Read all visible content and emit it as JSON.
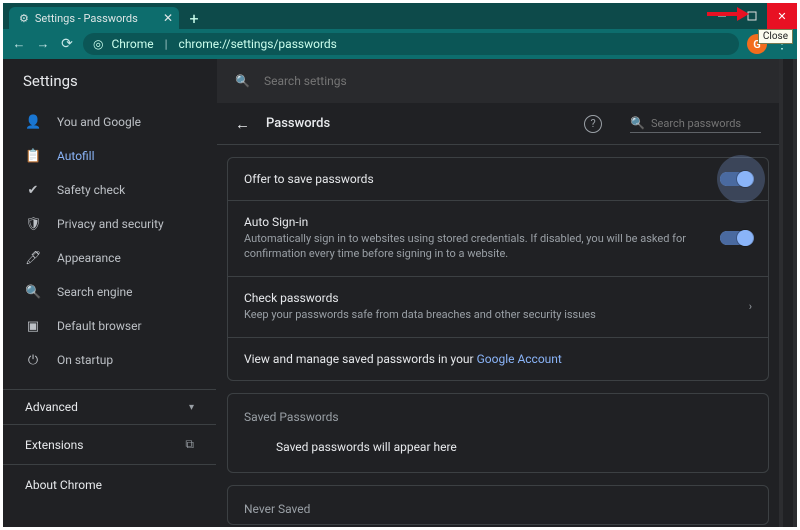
{
  "window": {
    "tab_title": "Settings - Passwords",
    "tooltip_close": "Close"
  },
  "omnibox": {
    "host": "Chrome",
    "path": "chrome://settings/passwords"
  },
  "avatar_letter": "G",
  "settings_header": "Settings",
  "sidebar": {
    "items": [
      {
        "label": "You and Google"
      },
      {
        "label": "Autofill"
      },
      {
        "label": "Safety check"
      },
      {
        "label": "Privacy and security"
      },
      {
        "label": "Appearance"
      },
      {
        "label": "Search engine"
      },
      {
        "label": "Default browser"
      },
      {
        "label": "On startup"
      }
    ],
    "advanced": "Advanced",
    "extensions": "Extensions",
    "about": "About Chrome"
  },
  "searchbar_placeholder": "Search settings",
  "page": {
    "title": "Passwords",
    "search_placeholder": "Search passwords",
    "offer_save": "Offer to save passwords",
    "auto_signin_title": "Auto Sign-in",
    "auto_signin_desc": "Automatically sign in to websites using stored credentials. If disabled, you will be asked for confirmation every time before signing in to a website.",
    "check_title": "Check passwords",
    "check_desc": "Keep your passwords safe from data breaches and other security issues",
    "manage_prefix": "View and manage saved passwords in your ",
    "manage_link": "Google Account",
    "saved_label": "Saved Passwords",
    "saved_empty": "Saved passwords will appear here",
    "never_saved_label": "Never Saved"
  },
  "toggles": {
    "offer_save": true,
    "auto_signin": true
  }
}
